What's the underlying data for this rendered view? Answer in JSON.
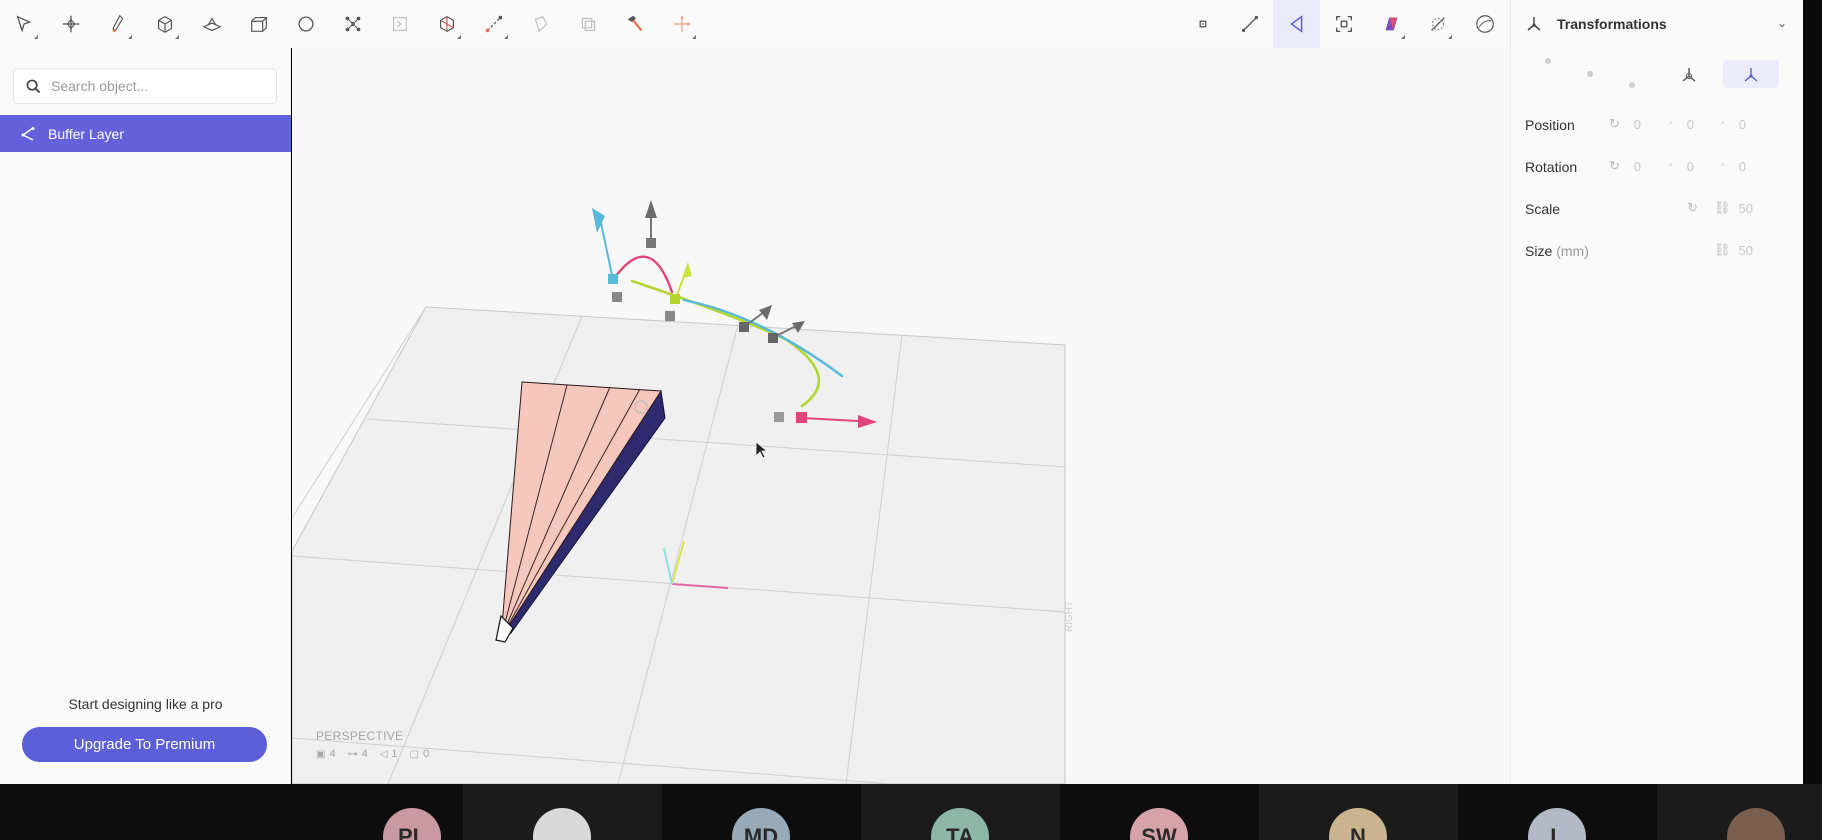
{
  "toolbar": {
    "left_tools": [
      {
        "icon": "select-arrow-icon"
      },
      {
        "icon": "add-point-icon"
      },
      {
        "icon": "pen-icon"
      },
      {
        "icon": "cube-icon"
      },
      {
        "icon": "extrude-icon"
      },
      {
        "icon": "box-open-icon"
      },
      {
        "icon": "circle-shape-icon"
      },
      {
        "icon": "nodes-icon"
      },
      {
        "icon": "image-plane-icon"
      },
      {
        "icon": "boolean-icon"
      },
      {
        "icon": "path-icon"
      },
      {
        "icon": "mirror-icon"
      },
      {
        "icon": "array-icon"
      },
      {
        "icon": "hammer-icon"
      },
      {
        "icon": "axis-transform-icon"
      }
    ],
    "right_tools": [
      {
        "icon": "point-snap-icon"
      },
      {
        "icon": "edge-icon"
      },
      {
        "icon": "vertex-select-icon"
      },
      {
        "icon": "focus-icon"
      },
      {
        "icon": "material-icon"
      },
      {
        "icon": "hide-icon"
      },
      {
        "icon": "sphere-view-icon"
      }
    ]
  },
  "left_panel": {
    "search_placeholder": "Search object...",
    "layers": [
      {
        "label": "Buffer Layer"
      }
    ],
    "promo_text": "Start designing like a pro",
    "upgrade_label": "Upgrade To Premium"
  },
  "viewport": {
    "view_name": "PERSPECTIVE",
    "stats": [
      {
        "icon": "face-count-icon",
        "value": "4"
      },
      {
        "icon": "edge-count-icon",
        "value": "4"
      },
      {
        "icon": "vertex-count-icon",
        "value": "1"
      },
      {
        "icon": "object-count-icon",
        "value": "0"
      }
    ],
    "side_label": "RIGHT"
  },
  "right_panel": {
    "title": "Transformations",
    "properties": [
      {
        "label": "Position",
        "unit": "",
        "values": [
          "0",
          "0",
          "0"
        ]
      },
      {
        "label": "Rotation",
        "unit": "",
        "values": [
          "0",
          "0",
          "0"
        ]
      },
      {
        "label": "Scale",
        "unit": "",
        "values": [
          "50"
        ]
      },
      {
        "label": "Size",
        "unit": "(mm)",
        "values": [
          "50"
        ]
      }
    ],
    "colors": {
      "accent": "#5c5fd8"
    }
  },
  "meeting": {
    "participants": [
      {
        "initials": "PL",
        "color": "#c99aa2"
      },
      {
        "initials": "",
        "color": "#d9d9d9"
      },
      {
        "initials": "MD",
        "color": "#98a9b8"
      },
      {
        "initials": "TA",
        "color": "#8fb7a8"
      },
      {
        "initials": "SW",
        "color": "#d6a3aa"
      },
      {
        "initials": "N",
        "color": "#c9b48f"
      },
      {
        "initials": "L",
        "color": "#b3b9c6"
      },
      {
        "initials": "",
        "color": "#7a5f4f"
      }
    ]
  }
}
